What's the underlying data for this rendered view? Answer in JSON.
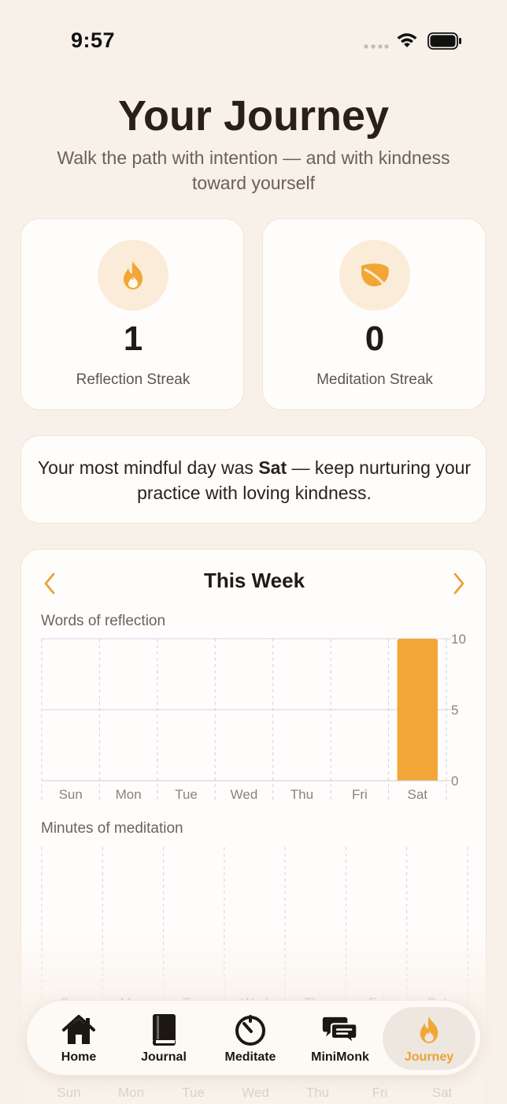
{
  "status": {
    "time": "9:57"
  },
  "header": {
    "title": "Your Journey",
    "subtitle": "Walk the path with intention — and with kindness toward yourself"
  },
  "streaks": [
    {
      "value": "1",
      "label": "Reflection Streak",
      "icon": "flame-icon"
    },
    {
      "value": "0",
      "label": "Meditation Streak",
      "icon": "leaf-icon"
    }
  ],
  "insight": {
    "prefix": "Your most mindful day was ",
    "day": "Sat",
    "suffix": " — keep nurturing your practice with loving kindness."
  },
  "week": {
    "title": "This Week"
  },
  "colors": {
    "accent": "#f2a636",
    "background": "#f8f1e9",
    "card": "#fffdfb"
  },
  "chart_data": [
    {
      "type": "bar",
      "title": "Words of reflection",
      "categories": [
        "Sun",
        "Mon",
        "Tue",
        "Wed",
        "Thu",
        "Fri",
        "Sat"
      ],
      "values": [
        0,
        0,
        0,
        0,
        0,
        0,
        10
      ],
      "yticks": [
        "0",
        "5",
        "10"
      ],
      "ylim": [
        0,
        10
      ]
    },
    {
      "type": "bar",
      "title": "Minutes of meditation",
      "categories": [
        "Sun",
        "Mon",
        "Tue",
        "Wed",
        "Thu",
        "Fri",
        "Sat"
      ],
      "values": [
        0,
        0,
        0,
        0,
        0,
        0,
        0
      ]
    }
  ],
  "tabs": [
    {
      "label": "Home",
      "icon": "home-icon"
    },
    {
      "label": "Journal",
      "icon": "book-icon"
    },
    {
      "label": "Meditate",
      "icon": "timer-icon"
    },
    {
      "label": "MiniMonk",
      "icon": "chat-icon"
    },
    {
      "label": "Journey",
      "icon": "flame-icon",
      "active": true
    }
  ]
}
